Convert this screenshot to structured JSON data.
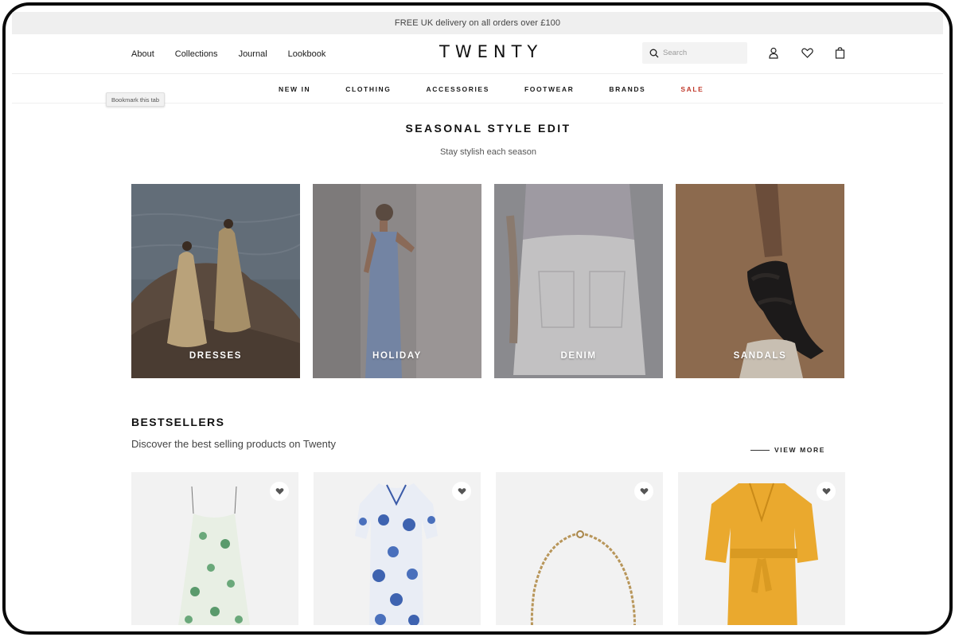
{
  "announcement": "FREE UK delivery on all orders over £100",
  "header": {
    "links": [
      "About",
      "Collections",
      "Journal",
      "Lookbook"
    ],
    "logo": "TWENTY",
    "search_placeholder": "Search",
    "icons": [
      "account-icon",
      "heart-icon",
      "bag-icon"
    ]
  },
  "category_nav": {
    "items": [
      "NEW IN",
      "CLOTHING",
      "ACCESSORIES",
      "FOOTWEAR",
      "BRANDS"
    ],
    "sale": "SALE",
    "sale_color": "#c0392b"
  },
  "tooltip": "Bookmark this tab",
  "seasonal": {
    "title": "SEASONAL STYLE EDIT",
    "subtitle": "Stay stylish each season",
    "tiles": [
      "DRESSES",
      "HOLIDAY",
      "DENIM",
      "SANDALS"
    ]
  },
  "bestsellers": {
    "title": "BESTSELLERS",
    "subtitle": "Discover the best selling products on Twenty",
    "view_more": "VIEW MORE"
  }
}
